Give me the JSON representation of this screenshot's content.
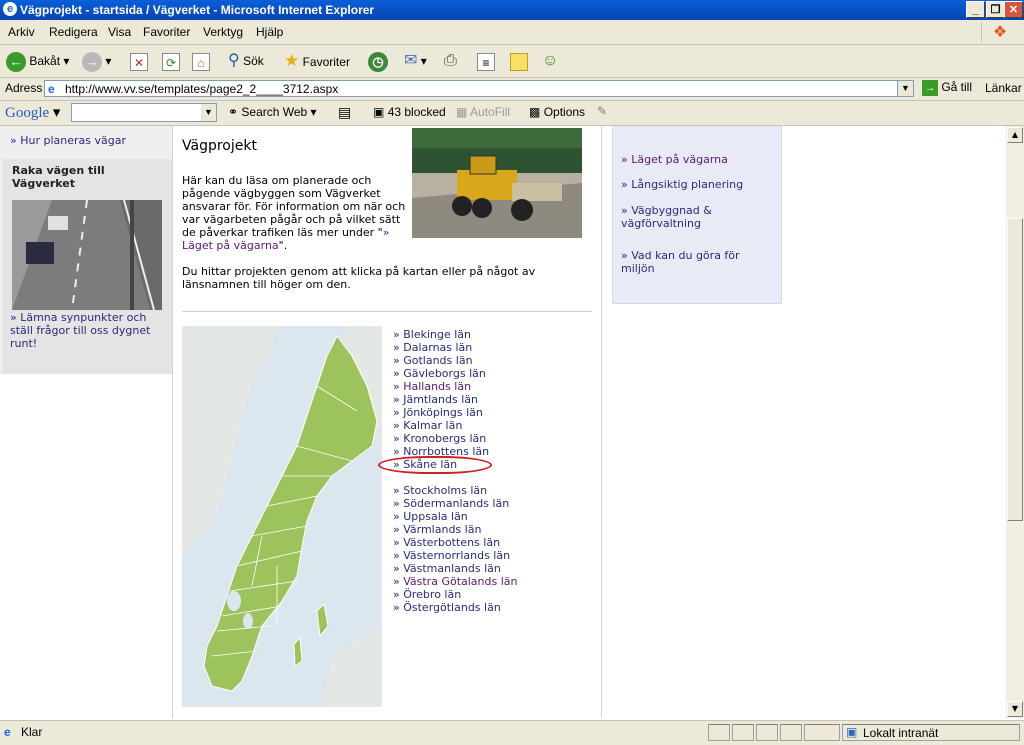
{
  "window": {
    "title": "Vägprojekt - startsida / Vägverket - Microsoft Internet Explorer"
  },
  "menu": [
    "Arkiv",
    "Redigera",
    "Visa",
    "Favoriter",
    "Verktyg",
    "Hjälp"
  ],
  "toolbar": {
    "back": "Bakåt",
    "search": "Sök",
    "favorites": "Favoriter"
  },
  "address": {
    "label": "Adress",
    "url": "http://www.vv.se/templates/page2_2____3712.aspx",
    "go": "Gå till",
    "links": "Länkar"
  },
  "googlebar": {
    "logo": "Google",
    "search_web": "Search Web",
    "blocked": "43 blocked",
    "autofill": "AutoFill",
    "options": "Options"
  },
  "left": {
    "link": "» Hur planeras vägar",
    "raka_heading": "Raka vägen till Vägverket",
    "lamna": "» Lämna synpunkter och ställ frågor till oss dygnet runt!"
  },
  "main": {
    "heading": "Vägprojekt",
    "intro": "Här kan du läsa om planerade och pågende vägbyggen som Vägverket ansvarar för. För information om när och var vägarbeten pågår och på vilket sätt de påverkar trafiken läs mer under \"",
    "intro_link": "» Läget på vägarna",
    "intro_end": "\".",
    "intro2": "Du hittar projekten genom att klicka på kartan eller på något av länsnamnen till höger om den."
  },
  "lan": [
    {
      "name": "» Blekinge län",
      "visited": false
    },
    {
      "name": "» Dalarnas län",
      "visited": false
    },
    {
      "name": "» Gotlands län",
      "visited": false
    },
    {
      "name": "» Gävleborgs län",
      "visited": false
    },
    {
      "name": "» Hallands län",
      "visited": true
    },
    {
      "name": "» Jämtlands län",
      "visited": false
    },
    {
      "name": "» Jönköpings län",
      "visited": false
    },
    {
      "name": "» Kalmar län",
      "visited": false
    },
    {
      "name": "» Kronobergs län",
      "visited": false
    },
    {
      "name": "» Norrbottens län",
      "visited": false
    },
    {
      "name": "» Skåne län",
      "visited": false
    },
    {
      "name": "» Stockholms län",
      "visited": false
    },
    {
      "name": "» Södermanlands län",
      "visited": false
    },
    {
      "name": "» Uppsala län",
      "visited": false
    },
    {
      "name": "» Värmlands län",
      "visited": false
    },
    {
      "name": "» Västerbottens län",
      "visited": false
    },
    {
      "name": "» Västernorrlands län",
      "visited": false
    },
    {
      "name": "» Västmanlands län",
      "visited": false
    },
    {
      "name": "» Västra Götalands län",
      "visited": true
    },
    {
      "name": "» Örebro län",
      "visited": false
    },
    {
      "name": "» Östergötlands län",
      "visited": false
    }
  ],
  "right_links": [
    {
      "text": "» Läget på vägarna",
      "visited": true
    },
    {
      "text": "» Långsiktig planering",
      "visited": false
    },
    {
      "text": "» Vägbyggnad & vägförvaltning",
      "visited": false
    },
    {
      "text": "» Vad kan du göra för miljön",
      "visited": false
    }
  ],
  "status": {
    "left": "Klar",
    "zone": "Lokalt intranät"
  },
  "colors": {
    "link": "#2a2a7a",
    "visited": "#5a1a6a",
    "highlight_ellipse": "#d02020",
    "map_land": "#9cc35c",
    "map_sea": "#dce6ef"
  }
}
